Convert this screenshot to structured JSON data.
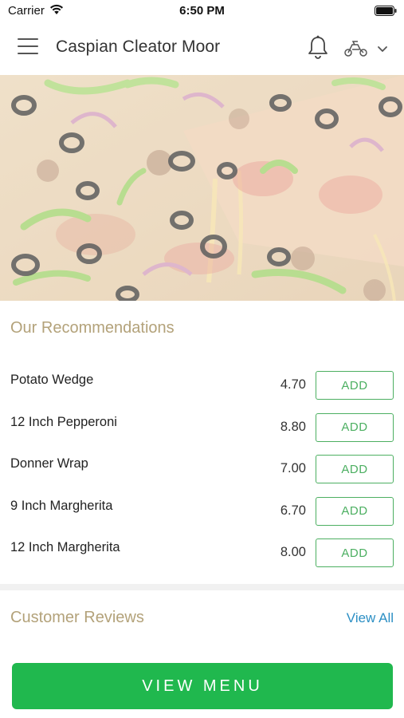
{
  "status_bar": {
    "carrier": "Carrier",
    "time": "6:50 PM",
    "icons": [
      "wifi-icon",
      "battery-icon"
    ]
  },
  "header": {
    "store_name": "Caspian Cleator Moor",
    "icons": [
      "menu-icon",
      "bell-icon",
      "delivery-icon",
      "chevron-down-icon"
    ]
  },
  "hero": {
    "image": "pizza-photo"
  },
  "recommendations": {
    "title": "Our Recommendations",
    "add_label": "ADD",
    "items": [
      {
        "name": "Potato Wedge",
        "price": "4.70",
        "action": "ADD"
      },
      {
        "name": "12 Inch Pepperoni",
        "price": "8.80",
        "action": "ADD"
      },
      {
        "name": "Donner Wrap",
        "price": "7.00",
        "action": "ADD"
      },
      {
        "name": "9 Inch Margherita",
        "price": "6.70",
        "action": "ADD"
      },
      {
        "name": "12 Inch Margherita",
        "price": "8.00",
        "action": "ADD"
      }
    ]
  },
  "reviews": {
    "title": "Customer Reviews",
    "view_all": "View All"
  },
  "footer": {
    "view_menu": "VIEW MENU"
  },
  "colors": {
    "accent_green": "#20b84e",
    "section_title": "#b3a27a",
    "link_blue": "#2c8fc4"
  }
}
